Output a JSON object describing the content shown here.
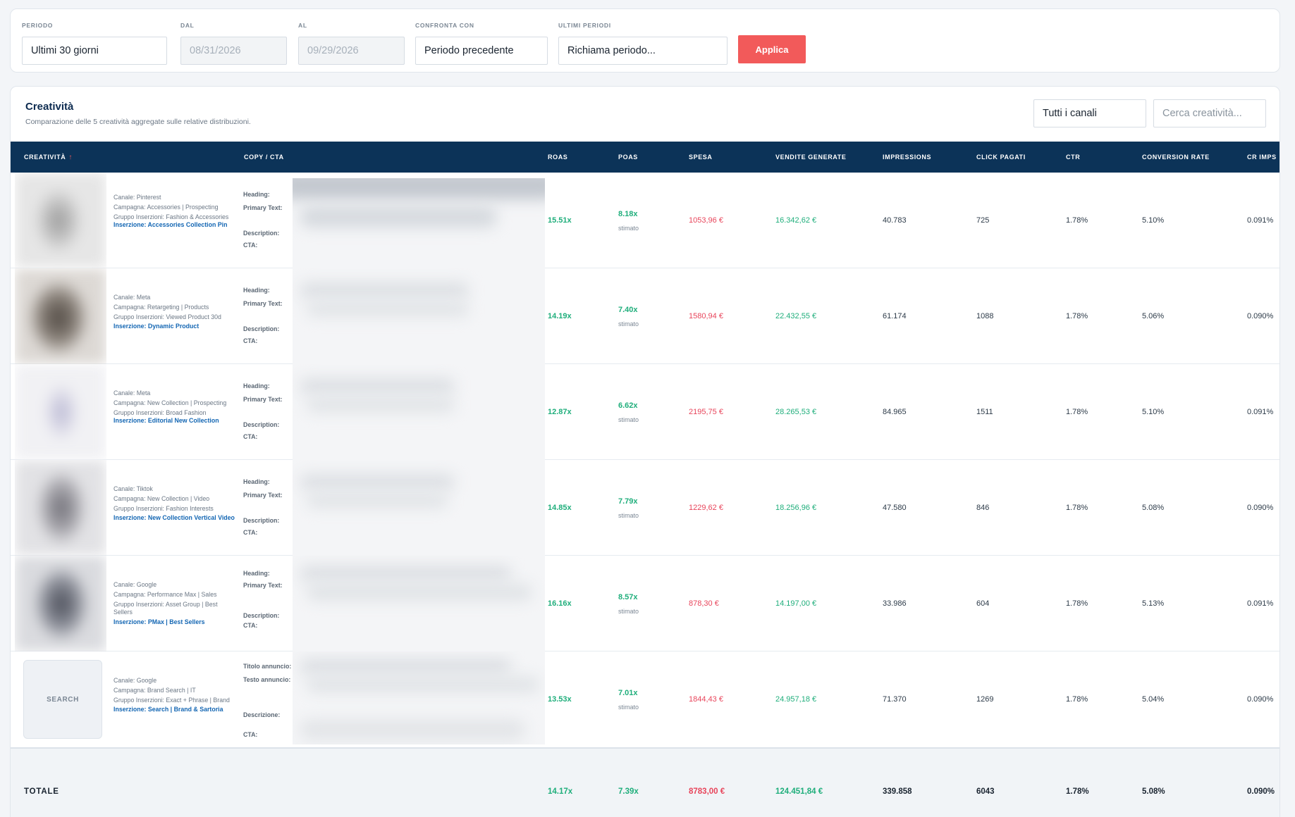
{
  "filters": {
    "periodo": {
      "label": "PERIODO",
      "value": "Ultimi 30 giorni"
    },
    "dal": {
      "label": "DAL",
      "value": "08/31/2026"
    },
    "al": {
      "label": "AL",
      "value": "09/29/2026"
    },
    "confronta": {
      "label": "CONFRONTA CON",
      "value": "Periodo precedente"
    },
    "ultimi": {
      "label": "ULTIMI PERIODI",
      "value": "Richiama periodo..."
    },
    "apply_label": "Applica"
  },
  "card": {
    "title": "Creatività",
    "subtitle": "Comparazione delle 5 creatività aggregate sulle relative distribuzioni.",
    "channel_select": "Tutti i canali",
    "search_placeholder": "Cerca creatività..."
  },
  "columns": {
    "creativita": "CREATIVITÀ",
    "copy": "COPY / CTA",
    "roas": "ROAS",
    "poas": "POAS",
    "spesa": "SPESA",
    "vendite": "VENDITE GENERATE",
    "impressions": "IMPRESSIONS",
    "click": "CLICK PAGATI",
    "ctr": "CTR",
    "conv": "CONVERSION RATE",
    "crimps": "CR IMPS"
  },
  "accent_colors": {
    "header_bg": "#0c3358",
    "positive": "#1fae7b",
    "negative": "#e8455b",
    "apply_button": "#f25a5a",
    "link": "#1366b3"
  },
  "rows": [
    {
      "canale": "Canale: Pinterest",
      "campagna": "Campagna: Accessories | Prospecting",
      "gruppo": "Gruppo Inserzioni: Fashion & Accessories",
      "inserzione": "Inserzione: Accessories Collection Pin",
      "copy_labels": [
        "Heading:",
        "Primary Text:",
        "Description:",
        "CTA:"
      ],
      "roas": "15.51x",
      "poas": "8.18x",
      "poas_note": "stimato",
      "spesa": "1053,96 €",
      "vendite": "16.342,62 €",
      "impressions": "40.783",
      "click": "725",
      "ctr": "1.78%",
      "conv": "5.10%",
      "crimps": "0.091%"
    },
    {
      "canale": "Canale: Meta",
      "campagna": "Campagna: Retargeting | Products",
      "gruppo": "Gruppo Inserzioni: Viewed Product 30d",
      "inserzione": "Inserzione: Dynamic Product",
      "copy_labels": [
        "Heading:",
        "Primary Text:",
        "Description:",
        "CTA:"
      ],
      "roas": "14.19x",
      "poas": "7.40x",
      "poas_note": "stimato",
      "spesa": "1580,94 €",
      "vendite": "22.432,55 €",
      "impressions": "61.174",
      "click": "1088",
      "ctr": "1.78%",
      "conv": "5.06%",
      "crimps": "0.090%"
    },
    {
      "canale": "Canale: Meta",
      "campagna": "Campagna: New Collection | Prospecting",
      "gruppo": "Gruppo Inserzioni: Broad Fashion",
      "inserzione": "Inserzione: Editorial New Collection",
      "copy_labels": [
        "Heading:",
        "Primary Text:",
        "Description:",
        "CTA:"
      ],
      "roas": "12.87x",
      "poas": "6.62x",
      "poas_note": "stimato",
      "spesa": "2195,75 €",
      "vendite": "28.265,53 €",
      "impressions": "84.965",
      "click": "1511",
      "ctr": "1.78%",
      "conv": "5.10%",
      "crimps": "0.091%"
    },
    {
      "canale": "Canale: Tiktok",
      "campagna": "Campagna: New Collection | Video",
      "gruppo": "Gruppo Inserzioni: Fashion Interests",
      "inserzione": "Inserzione: New Collection Vertical Video",
      "copy_labels": [
        "Heading:",
        "Primary Text:",
        "Description:",
        "CTA:"
      ],
      "roas": "14.85x",
      "poas": "7.79x",
      "poas_note": "stimato",
      "spesa": "1229,62 €",
      "vendite": "18.256,96 €",
      "impressions": "47.580",
      "click": "846",
      "ctr": "1.78%",
      "conv": "5.08%",
      "crimps": "0.090%"
    },
    {
      "canale": "Canale: Google",
      "campagna": "Campagna: Performance Max | Sales",
      "gruppo": "Gruppo Inserzioni: Asset Group | Best Sellers",
      "inserzione": "Inserzione: PMax | Best Sellers",
      "copy_labels": [
        "Heading:",
        "Primary Text:",
        "Description:",
        "CTA:"
      ],
      "roas": "16.16x",
      "poas": "8.57x",
      "poas_note": "stimato",
      "spesa": "878,30 €",
      "vendite": "14.197,00 €",
      "impressions": "33.986",
      "click": "604",
      "ctr": "1.78%",
      "conv": "5.13%",
      "crimps": "0.091%"
    },
    {
      "search_label": "SEARCH",
      "canale": "Canale: Google",
      "campagna": "Campagna: Brand Search | IT",
      "gruppo": "Gruppo Inserzioni: Exact + Phrase | Brand",
      "inserzione": "Inserzione: Search | Brand & Sartoria",
      "copy_labels": [
        "Titolo annuncio:",
        "Testo annuncio:",
        "Descrizione:",
        "CTA:"
      ],
      "roas": "13.53x",
      "poas": "7.01x",
      "poas_note": "stimato",
      "spesa": "1844,43 €",
      "vendite": "24.957,18 €",
      "impressions": "71.370",
      "click": "1269",
      "ctr": "1.78%",
      "conv": "5.04%",
      "crimps": "0.090%"
    }
  ],
  "totals": {
    "label": "TOTALE",
    "roas": "14.17x",
    "poas": "7.39x",
    "spesa": "8783,00 €",
    "vendite": "124.451,84 €",
    "impressions": "339.858",
    "click": "6043",
    "ctr": "1.78%",
    "conv": "5.08%",
    "crimps": "0.090%"
  }
}
